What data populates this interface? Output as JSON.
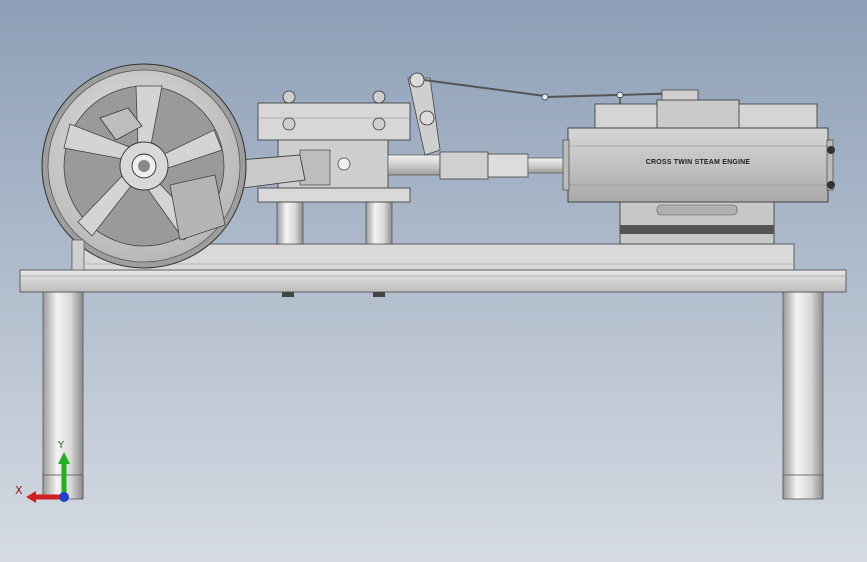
{
  "viewport": {
    "background_top": "#8d9fb7",
    "background_bottom": "#d6dbe3"
  },
  "model": {
    "cylinder_label": "CROSS TWIN STEAM ENGINE"
  },
  "triad": {
    "x_label": "X",
    "y_label": "Y",
    "x_color": "#d02020",
    "y_color": "#20b020",
    "z_color": "#2040d0"
  }
}
